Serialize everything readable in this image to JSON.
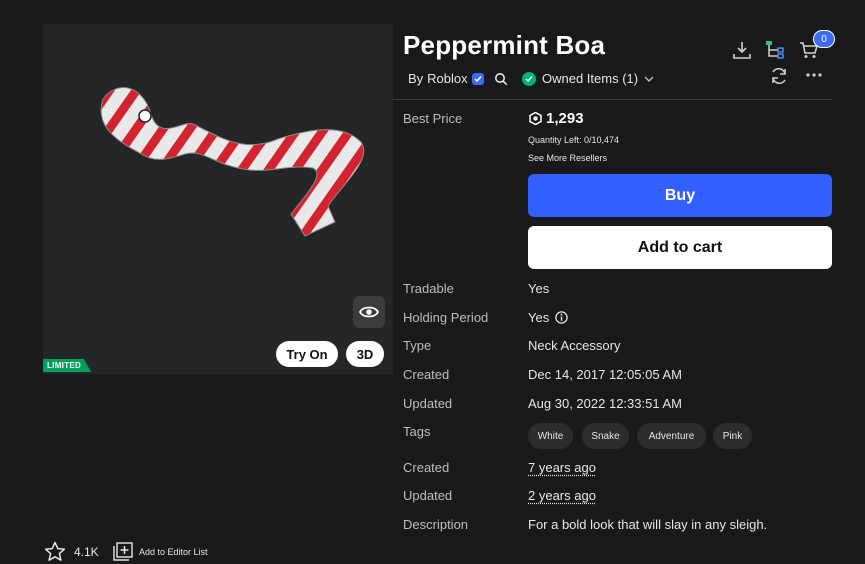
{
  "item": {
    "title": "Peppermint Boa",
    "by_prefix": "By",
    "creator": "Roblox",
    "owned_label": "Owned Items (1)",
    "limited_badge": "LIMITED",
    "try_on_label": "Try On",
    "view_3d_label": "3D"
  },
  "header": {
    "cart_count": "0"
  },
  "details": {
    "best_price_label": "Best Price",
    "price": "1,293",
    "quantity_left": "Quantity Left: 0/10,474",
    "see_more_resellers": "See More Resellers",
    "buy_label": "Buy",
    "add_to_cart_label": "Add to cart",
    "tradable_label": "Tradable",
    "tradable_value": "Yes",
    "holding_label": "Holding Period",
    "holding_value": "Yes",
    "type_label": "Type",
    "type_value": "Neck Accessory",
    "created_label": "Created",
    "created_value": "Dec 14, 2017 12:05:05 AM",
    "updated_label": "Updated",
    "updated_value": "Aug 30, 2022 12:33:51 AM",
    "tags_label": "Tags",
    "tags": [
      "White",
      "Snake",
      "Adventure",
      "Pink"
    ],
    "created2_label": "Created",
    "created2_value": "7 years ago",
    "updated2_label": "Updated",
    "updated2_value": "2 years ago",
    "description_label": "Description",
    "description_value": "For a bold look that will slay in any sleigh."
  },
  "footer": {
    "favorites_count": "4.1K",
    "editor_list_label": "Add to Editor List"
  },
  "colors": {
    "accent_blue": "#335fff",
    "owned_green": "#00b06f",
    "limited_green": "#00a05c"
  },
  "icons": [
    "download-icon",
    "hierarchy-icon",
    "cart-icon",
    "refresh-icon",
    "more-icon",
    "search-icon",
    "verified-icon",
    "eye-icon",
    "info-icon",
    "star-icon",
    "add-list-icon",
    "robux-icon"
  ]
}
